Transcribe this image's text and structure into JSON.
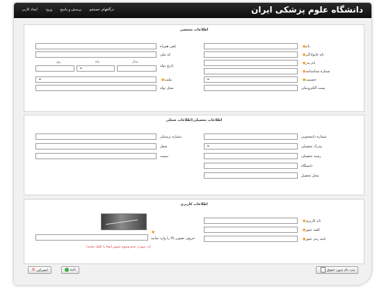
{
  "header": {
    "site_title": "دانشگاه علوم پزشکی ایران"
  },
  "menu": [
    "درگاههای جستجو",
    "پرسش و پاسخ",
    "ورود",
    "ایجاد کاربر"
  ],
  "personal": {
    "title": "اطلاعات شخصی",
    "labels": {
      "name": "نام",
      "family": "نام خانوادگی",
      "father": "نام پدر",
      "id_number": "شماره شناسنامه",
      "gender": "جنسیت",
      "email": "پست الکترونیکی",
      "mobile": "تلفن همراه",
      "national_code": "کد ملی",
      "birth_date": "تاریخ تولد",
      "nationality": "ملیت",
      "birth_place": "محل تولد",
      "year": "سال",
      "month": "ماه",
      "day": "روز"
    }
  },
  "education": {
    "title": "اطلاعات تحصیلی/اطلاعات شغلی",
    "labels": {
      "student_no": "شماره دانشجویی",
      "degree": "مدرک تحصیلی",
      "field": "رشته تحصیلی",
      "university": "دانشگاه",
      "place": "محل تحصیل",
      "personnel_no": "شماره پرسنلی",
      "job": "شغل",
      "position": "سمت"
    }
  },
  "account": {
    "title": "اطلاعات کاربری",
    "labels": {
      "username": "نام کاربری",
      "password": "کلمه عبور",
      "confirm": "تایید رمز عبور",
      "captcha": "حروف تصویر بالا را وارد نمایید"
    },
    "captcha_note": "(در صورت عدم وضوح تصویر اینجا را کلیک نمایید)"
  },
  "buttons": {
    "terms": "ثبت نام بدون حقوق",
    "submit": "تایید",
    "cancel": "انصراف"
  },
  "colors": {
    "required": "#f5a623",
    "note": "#d32f2f",
    "ok": "#3cb043",
    "cancel": "#e53935"
  },
  "icons": {
    "required": "required-dot-icon",
    "select": "chevron-down-icon",
    "ok": "check-circle-icon",
    "cancel": "x-icon"
  }
}
